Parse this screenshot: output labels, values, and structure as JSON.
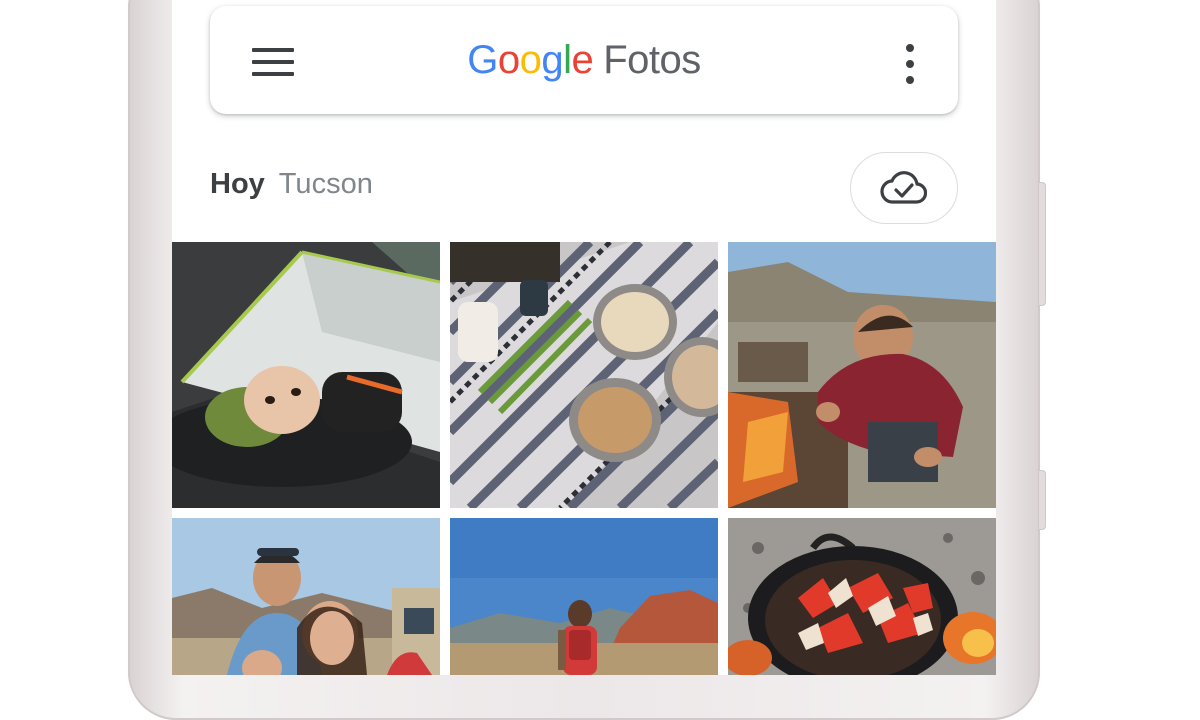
{
  "app": {
    "logo_letters": [
      {
        "ch": "G",
        "color": "#4285F4"
      },
      {
        "ch": "o",
        "color": "#EA4335"
      },
      {
        "ch": "o",
        "color": "#FBBC05"
      },
      {
        "ch": "g",
        "color": "#4285F4"
      },
      {
        "ch": "l",
        "color": "#34A853"
      },
      {
        "ch": "e",
        "color": "#EA4335"
      }
    ],
    "product_name": "Fotos"
  },
  "icons": {
    "menu": "hamburger-menu-icon",
    "more": "more-vertical-icon",
    "backup": "cloud-check-icon"
  },
  "section": {
    "day": "Hoy",
    "place": "Tucson"
  },
  "photos": [
    {
      "id": "tent-child",
      "subject": "child in green hat lying in tent"
    },
    {
      "id": "camp-food",
      "subject": "bowls of camp food on striped blanket"
    },
    {
      "id": "man-fire",
      "subject": "man tending campfire in desert"
    },
    {
      "id": "family-selfie",
      "subject": "family selfie by car"
    },
    {
      "id": "hiker",
      "subject": "hiker with red backpack in desert"
    },
    {
      "id": "dutch-oven",
      "subject": "dutch oven of vegetables over fire"
    }
  ]
}
